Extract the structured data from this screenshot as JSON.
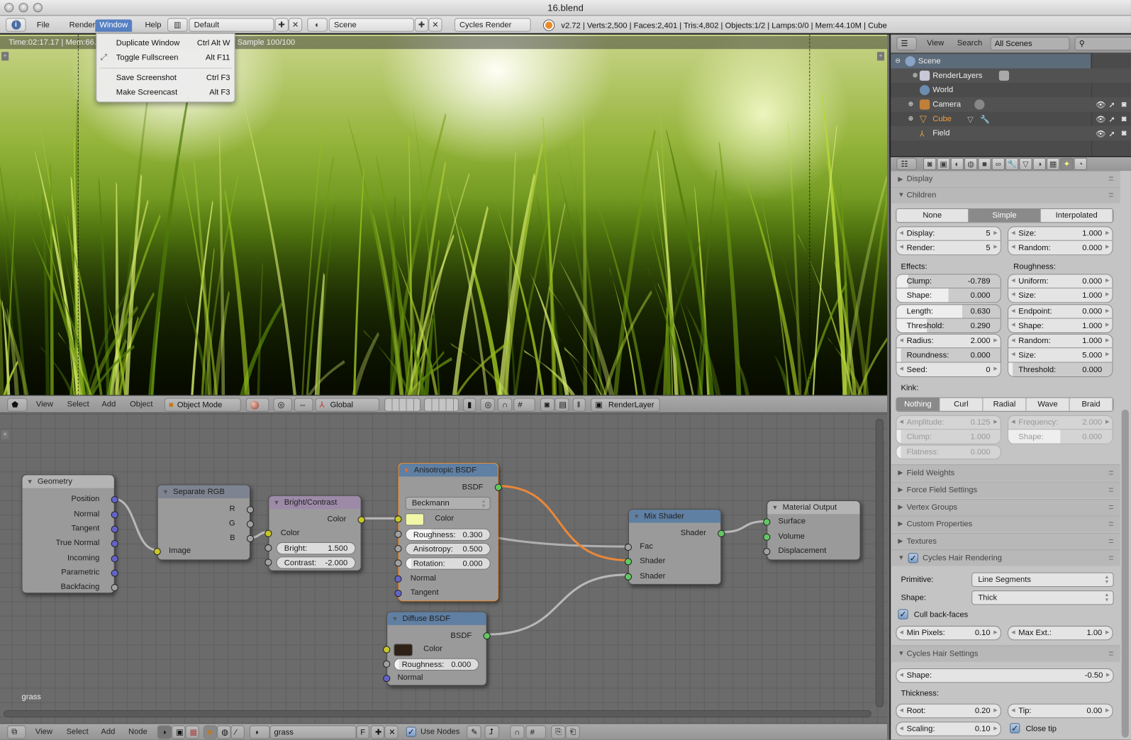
{
  "window": {
    "title": "16.blend"
  },
  "info_header": {
    "menus": [
      "File",
      "Render",
      "Window",
      "Help"
    ],
    "layout": "Default",
    "scene": "Scene",
    "engine": "Cycles Render",
    "stats": "v2.72 | Verts:2,500 | Faces:2,401 | Tris:4,802 | Objects:1/2 | Lamps:0/0 | Mem:44.10M | Cube"
  },
  "window_menu": {
    "items": [
      {
        "label": "Duplicate Window",
        "shortcut": "Ctrl Alt W"
      },
      {
        "label": "Toggle Fullscreen",
        "shortcut": "Alt F11"
      },
      {
        "label": "Save Screenshot",
        "shortcut": "Ctrl F3"
      },
      {
        "label": "Make Screencast",
        "shortcut": "Alt F3"
      }
    ]
  },
  "viewport": {
    "render_info_left": "Time:02:17.17 | Mem:66.",
    "render_info_right": "Sample 100/100"
  },
  "view3d_header": {
    "menus": [
      "View",
      "Select",
      "Add",
      "Object"
    ],
    "mode": "Object Mode",
    "orientation": "Global",
    "render_layer": "RenderLayer"
  },
  "node_editor": {
    "material_label": "grass",
    "nodes": {
      "geometry": {
        "title": "Geometry",
        "outputs": [
          "Position",
          "Normal",
          "Tangent",
          "True Normal",
          "Incoming",
          "Parametric",
          "Backfacing"
        ]
      },
      "separate_rgb": {
        "title": "Separate RGB",
        "outputs": [
          "R",
          "G",
          "B"
        ],
        "input": "Image"
      },
      "bright_contrast": {
        "title": "Bright/Contrast",
        "output": "Color",
        "input": "Color",
        "bright_label": "Bright:",
        "bright": "1.500",
        "contrast_label": "Contrast:",
        "contrast": "-2.000"
      },
      "anisotropic": {
        "title": "Anisotropic BSDF",
        "output": "BSDF",
        "distribution": "Beckmann",
        "color_label": "Color",
        "color": "#f2f7a8",
        "roughness_label": "Roughness:",
        "roughness": "0.300",
        "anisotropy_label": "Anisotropy:",
        "anisotropy": "0.500",
        "rotation_label": "Rotation:",
        "rotation": "0.000",
        "normal": "Normal",
        "tangent": "Tangent"
      },
      "diffuse": {
        "title": "Diffuse BSDF",
        "output": "BSDF",
        "color_label": "Color",
        "color": "#2e2216",
        "roughness_label": "Roughness:",
        "roughness": "0.000",
        "normal": "Normal"
      },
      "mix": {
        "title": "Mix Shader",
        "output": "Shader",
        "inputs": [
          "Fac",
          "Shader",
          "Shader"
        ]
      },
      "output": {
        "title": "Material Output",
        "inputs": [
          "Surface",
          "Volume",
          "Displacement"
        ]
      }
    }
  },
  "node_header": {
    "menus": [
      "View",
      "Select",
      "Add",
      "Node"
    ],
    "material": "grass",
    "fake_user": "F",
    "use_nodes_label": "Use Nodes",
    "use_nodes": true
  },
  "outliner": {
    "header": {
      "view": "View",
      "search": "Search",
      "filter": "All Scenes"
    },
    "items": [
      "Scene",
      "RenderLayers",
      "World",
      "Camera",
      "Cube",
      "Field"
    ]
  },
  "properties": {
    "panels": {
      "display": "Display",
      "children": "Children"
    },
    "children_mode": {
      "options": [
        "None",
        "Simple",
        "Interpolated"
      ],
      "selected": "Simple"
    },
    "display": {
      "label": "Display:",
      "value": "5"
    },
    "render": {
      "label": "Render:",
      "value": "5"
    },
    "size": {
      "label": "Size:",
      "value": "1.000"
    },
    "random": {
      "label": "Random:",
      "value": "0.000"
    },
    "effects_label": "Effects:",
    "roughness_label": "Roughness:",
    "clump": {
      "label": "Clump:",
      "value": "-0.789",
      "fill": 0.11
    },
    "clump_shape": {
      "label": "Shape:",
      "value": "0.000",
      "fill": 0.5
    },
    "length": {
      "label": "Length:",
      "value": "0.630",
      "fill": 0.63
    },
    "threshold": {
      "label": "Threshold:",
      "value": "0.290",
      "fill": 0.29
    },
    "radius": {
      "label": "Radius:",
      "value": "2.000"
    },
    "roundness": {
      "label": "Roundness:",
      "value": "0.000",
      "fill": 0.0
    },
    "seed": {
      "label": "Seed:",
      "value": "0"
    },
    "rough_uniform": {
      "label": "Uniform:",
      "value": "0.000"
    },
    "rough_size": {
      "label": "Size:",
      "value": "1.000"
    },
    "rough_endpoint": {
      "label": "Endpoint:",
      "value": "0.000"
    },
    "rough_end_shape": {
      "label": "Shape:",
      "value": "1.000"
    },
    "rough_random": {
      "label": "Random:",
      "value": "1.000"
    },
    "rough_rand_size": {
      "label": "Size:",
      "value": "5.000"
    },
    "rough_threshold": {
      "label": "Threshold:",
      "value": "0.000",
      "fill": 0.0
    },
    "kink_label": "Kink:",
    "kink": {
      "options": [
        "Nothing",
        "Curl",
        "Radial",
        "Wave",
        "Braid"
      ],
      "selected": "Nothing"
    },
    "amplitude": {
      "label": "Amplitude:",
      "value": "0.125"
    },
    "kink_clump": {
      "label": "Clump:",
      "value": "1.000"
    },
    "flatness": {
      "label": "Flatness:",
      "value": "0.000"
    },
    "frequency": {
      "label": "Frequency:",
      "value": "2.000"
    },
    "kink_shape": {
      "label": "Shape:",
      "value": "0.000",
      "fill": 0.5
    },
    "collapsed_panels": [
      "Field Weights",
      "Force Field Settings",
      "Vertex Groups",
      "Custom Properties",
      "Textures"
    ],
    "cycles_hair_rendering": {
      "title": "Cycles Hair Rendering",
      "enabled": true,
      "primitive_label": "Primitive:",
      "primitive": "Line Segments",
      "shape_label": "Shape:",
      "shape": "Thick",
      "cull_label": "Cull back-faces",
      "cull": true,
      "min_pixels": {
        "label": "Min Pixels:",
        "value": "0.10"
      },
      "max_ext": {
        "label": "Max Ext.:",
        "value": "1.00"
      }
    },
    "cycles_hair_settings": {
      "title": "Cycles Hair Settings",
      "shape": {
        "label": "Shape:",
        "value": "-0.50"
      },
      "thickness_label": "Thickness:",
      "root": {
        "label": "Root:",
        "value": "0.20"
      },
      "tip": {
        "label": "Tip:",
        "value": "0.00"
      },
      "scaling": {
        "label": "Scaling:",
        "value": "0.10"
      },
      "close_tip_label": "Close tip",
      "close_tip": true
    }
  }
}
